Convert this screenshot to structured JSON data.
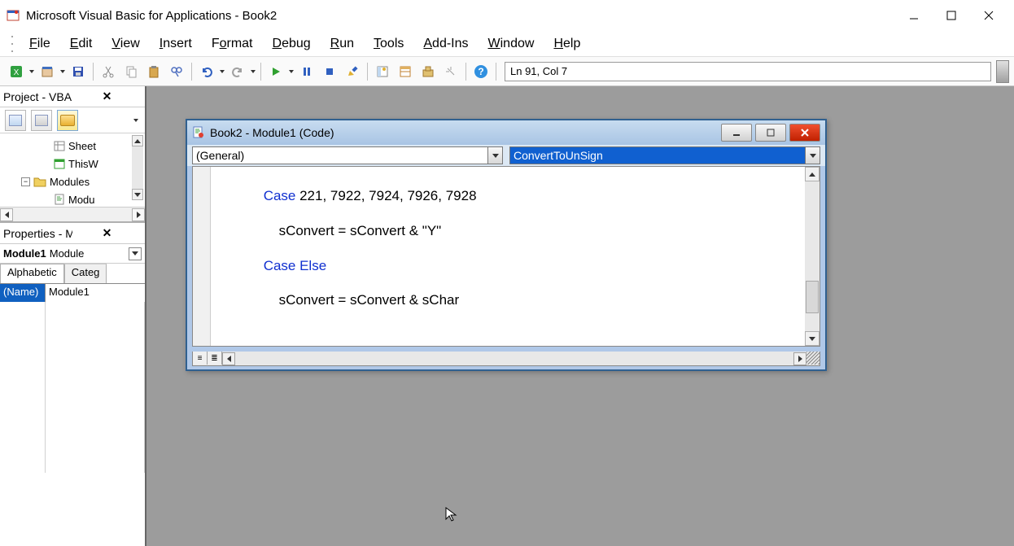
{
  "app_title": "Microsoft Visual Basic for Applications - Book2",
  "menus": {
    "file": "File",
    "edit": "Edit",
    "view": "View",
    "insert": "Insert",
    "format": "Format",
    "debug": "Debug",
    "run": "Run",
    "tools": "Tools",
    "addins": "Add-Ins",
    "window": "Window",
    "help": "Help"
  },
  "status_position": "Ln 91, Col 7",
  "project_panel": {
    "title": "Project - VBAProject",
    "tree": {
      "sheet": "Sheet",
      "thisw": "ThisW",
      "modules": "Modules",
      "module1": "Modu"
    }
  },
  "properties_panel": {
    "title": "Properties - Modul",
    "object_bold": "Module1",
    "object_type": "Module",
    "tab_alpha": "Alphabetic",
    "tab_categ": "Categ",
    "rows": {
      "name_key": "(Name)",
      "name_val": "Module1"
    }
  },
  "code_window": {
    "title": "Book2 - Module1 (Code)",
    "combo_left": "(General)",
    "combo_right": "ConvertToUnSign",
    "code": {
      "l1_kw": "Case",
      "l1_rest": " 221, 7922, 7924, 7926, 7928",
      "l2": "sConvert = sConvert & \"Y\"",
      "l3_kw": "Case Else",
      "l4": "sConvert = sConvert & sChar"
    }
  }
}
